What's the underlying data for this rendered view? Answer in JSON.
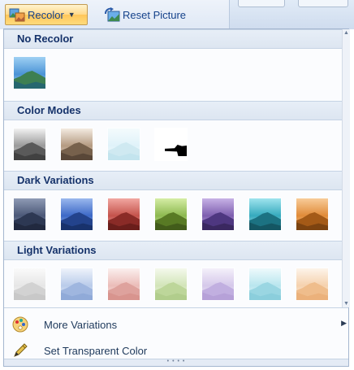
{
  "toolbar": {
    "recolor_label": "Recolor",
    "reset_label": "Reset Picture"
  },
  "sections": [
    {
      "title": "No Recolor",
      "thumbs": [
        {
          "name": "no-recolor-thumb",
          "sky": "linear-gradient(#9fd0f3,#4a93d6 55%,#bfe3fb)",
          "mtn": "#3d7f52",
          "mtn2": "#1f5f7a"
        }
      ]
    },
    {
      "title": "Color Modes",
      "thumbs": [
        {
          "name": "grayscale-thumb",
          "sky": "linear-gradient(#f2f2f2,#9a9a9a 55%,#e6e6e6)",
          "mtn": "#5a5a5a",
          "mtn2": "#3a3a3a"
        },
        {
          "name": "sepia-thumb",
          "sky": "linear-gradient(#f3ebe1,#b49a81 55%,#ece1d4)",
          "mtn": "#77614c",
          "mtn2": "#4f3f31"
        },
        {
          "name": "washout-thumb",
          "sky": "linear-gradient(#f4fbfd,#dff2f9 55%,#ffffff)",
          "mtn": "#cfe9f1",
          "mtn2": "#bfe1ec"
        },
        {
          "name": "black-and-white-thumb",
          "bw": true
        }
      ]
    },
    {
      "title": "Dark Variations",
      "thumbs": [
        {
          "name": "dark-blue-gray-thumb",
          "sky": "linear-gradient(#8f9bb5,#4b5877 55%,#a3aec6)",
          "mtn": "#2d3853",
          "mtn2": "#1d2438"
        },
        {
          "name": "dark-blue-thumb",
          "sky": "linear-gradient(#9ab8ee,#3c68c6 55%,#b3ccf5)",
          "mtn": "#23438c",
          "mtn2": "#162c61"
        },
        {
          "name": "dark-red-thumb",
          "sky": "linear-gradient(#f1a7a1,#c4524b 55%,#f4bdb7)",
          "mtn": "#8a2b27",
          "mtn2": "#5f1b18"
        },
        {
          "name": "dark-green-thumb",
          "sky": "linear-gradient(#d5eda5,#8cb84f 55%,#e1f3bd)",
          "mtn": "#587a24",
          "mtn2": "#3b5317"
        },
        {
          "name": "dark-purple-thumb",
          "sky": "linear-gradient(#c7b2e6,#7d5eae 55%,#d7c6ef)",
          "mtn": "#4e3780",
          "mtn2": "#342456"
        },
        {
          "name": "dark-aqua-thumb",
          "sky": "linear-gradient(#9fe4ee,#35a9bd 55%,#c0eef4)",
          "mtn": "#1c7282",
          "mtn2": "#124d58"
        },
        {
          "name": "dark-orange-thumb",
          "sky": "linear-gradient(#f8cc99,#e08a38 55%,#fbdab3)",
          "mtn": "#a45a17",
          "mtn2": "#6f3c0f"
        }
      ]
    },
    {
      "title": "Light Variations",
      "thumbs": [
        {
          "name": "light-gray-thumb",
          "sky": "linear-gradient(#fafafa,#e6e6e6 55%,#ffffff)",
          "mtn": "#d2d2d2",
          "mtn2": "#c4c4c4"
        },
        {
          "name": "light-blue-thumb",
          "sky": "linear-gradient(#eef3fb,#b9cbea 55%,#f6f9fd)",
          "mtn": "#9fb6df",
          "mtn2": "#8ba6d6"
        },
        {
          "name": "light-red-thumb",
          "sky": "linear-gradient(#fbefee,#ebbcb8 55%,#fdf6f5)",
          "mtn": "#dea29d",
          "mtn2": "#d58f89"
        },
        {
          "name": "light-green-thumb",
          "sky": "linear-gradient(#f4f9ec,#d2e4b8 55%,#fafcf6)",
          "mtn": "#bdd69a",
          "mtn2": "#aeca87"
        },
        {
          "name": "light-purple-thumb",
          "sky": "linear-gradient(#f4f0fa,#d5c8ea 55%,#faf8fd)",
          "mtn": "#c1afe0",
          "mtn2": "#b29cd6"
        },
        {
          "name": "light-aqua-thumb",
          "sky": "linear-gradient(#eefafc,#b8e5ee 55%,#f6fcfd)",
          "mtn": "#9ad6e2",
          "mtn2": "#86cbd9"
        },
        {
          "name": "light-orange-thumb",
          "sky": "linear-gradient(#fdf4ea,#f5d1ad 55%,#fef9f4)",
          "mtn": "#efbd8c",
          "mtn2": "#e9ae75"
        }
      ]
    }
  ],
  "menu": {
    "more_variations": "More Variations",
    "set_transparent": "Set Transparent Color"
  },
  "colors": {
    "accent": "#ffc65a",
    "section_header_bg": "#dde6f1",
    "text": "#1e395b"
  },
  "icons": {
    "recolor": "recolor-icon",
    "reset": "reset-picture-icon",
    "more_variations": "color-palette-icon",
    "set_transparent": "pen-icon"
  }
}
